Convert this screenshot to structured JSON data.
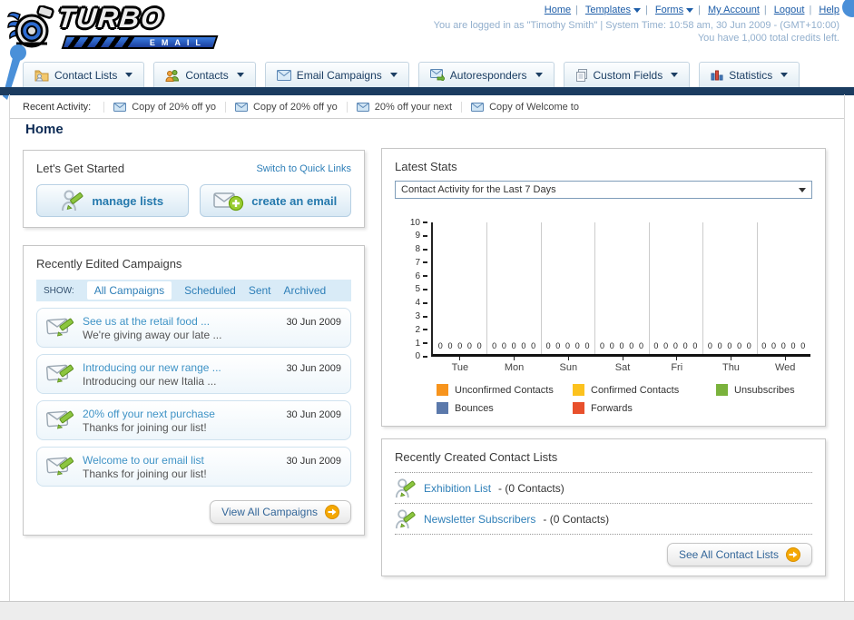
{
  "header": {
    "logo": {
      "title": "TURBO",
      "subtitle": "EMAIL"
    },
    "nav": [
      {
        "label": "Home",
        "dropdown": false
      },
      {
        "label": "Templates",
        "dropdown": true
      },
      {
        "label": "Forms",
        "dropdown": true
      },
      {
        "label": "My Account",
        "dropdown": false
      },
      {
        "label": "Logout",
        "dropdown": false
      },
      {
        "label": "Help",
        "dropdown": false
      }
    ],
    "login_line": "You are logged in as \"Timothy Smith\" | System Time: 10:58 am, 30 Jun 2009 - (GMT+10:00)",
    "credits_line": "You have 1,000 total credits left."
  },
  "tabs": [
    {
      "label": "Contact Lists",
      "icon": "folder-user-icon"
    },
    {
      "label": "Contacts",
      "icon": "users-icon"
    },
    {
      "label": "Email Campaigns",
      "icon": "envelope-icon"
    },
    {
      "label": "Autoresponders",
      "icon": "envelope-arrow-icon"
    },
    {
      "label": "Custom Fields",
      "icon": "pages-icon"
    },
    {
      "label": "Statistics",
      "icon": "bar-chart-icon"
    }
  ],
  "recent_activity": {
    "label": "Recent Activity:",
    "items": [
      "Copy of 20% off yo",
      "Copy of 20% off yo",
      "20% off your next",
      "Copy of Welcome to"
    ]
  },
  "page_title": "Home",
  "get_started": {
    "title": "Let's Get Started",
    "switch_link": "Switch to Quick Links",
    "buttons": [
      {
        "label": "manage lists"
      },
      {
        "label": "create an email"
      }
    ]
  },
  "campaigns": {
    "title": "Recently Edited Campaigns",
    "show_label": "SHOW:",
    "filters": [
      "All Campaigns",
      "Scheduled",
      "Sent",
      "Archived"
    ],
    "active_filter": "All Campaigns",
    "items": [
      {
        "title": "See us at the retail food ...",
        "subtitle": "We're giving away our late ...",
        "date": "30 Jun 2009"
      },
      {
        "title": "Introducing our new range ...",
        "subtitle": "Introducing our new Italia ...",
        "date": "30 Jun 2009"
      },
      {
        "title": "20% off your next purchase",
        "subtitle": "Thanks for joining our list!",
        "date": "30 Jun 2009"
      },
      {
        "title": "Welcome to our email list",
        "subtitle": "Thanks for joining our list!",
        "date": "30 Jun 2009"
      }
    ],
    "view_all_label": "View All Campaigns"
  },
  "stats": {
    "title": "Latest Stats",
    "dropdown_value": "Contact Activity for the Last 7 Days"
  },
  "chart_data": {
    "type": "bar",
    "title": "Contact Activity for the Last 7 Days",
    "categories": [
      "Tue",
      "Mon",
      "Sun",
      "Sat",
      "Fri",
      "Thu",
      "Wed"
    ],
    "series": [
      {
        "name": "Unconfirmed Contacts",
        "color": "#f7941d",
        "values": [
          0,
          0,
          0,
          0,
          0,
          0,
          0
        ]
      },
      {
        "name": "Confirmed Contacts",
        "color": "#fcc21e",
        "values": [
          0,
          0,
          0,
          0,
          0,
          0,
          0
        ]
      },
      {
        "name": "Unsubscribes",
        "color": "#7ab23c",
        "values": [
          0,
          0,
          0,
          0,
          0,
          0,
          0
        ]
      },
      {
        "name": "Bounces",
        "color": "#5b79ab",
        "values": [
          0,
          0,
          0,
          0,
          0,
          0,
          0
        ]
      },
      {
        "name": "Forwards",
        "color": "#e8502c",
        "values": [
          0,
          0,
          0,
          0,
          0,
          0,
          0
        ]
      }
    ],
    "xlabel": "",
    "ylabel": "",
    "ylim": [
      0,
      10
    ],
    "ytick_step": 1,
    "grid": true,
    "legend_position": "bottom"
  },
  "contact_lists": {
    "title": "Recently Created Contact Lists",
    "items": [
      {
        "name": "Exhibition List",
        "detail": "- (0 Contacts)"
      },
      {
        "name": "Newsletter Subscribers",
        "detail": "- (0 Contacts)"
      }
    ],
    "see_all_label": "See All Contact Lists"
  },
  "colors": {
    "accent_navy": "#1b3c60",
    "link_blue": "#2e7fb8",
    "orange_button": "#f5a802"
  }
}
